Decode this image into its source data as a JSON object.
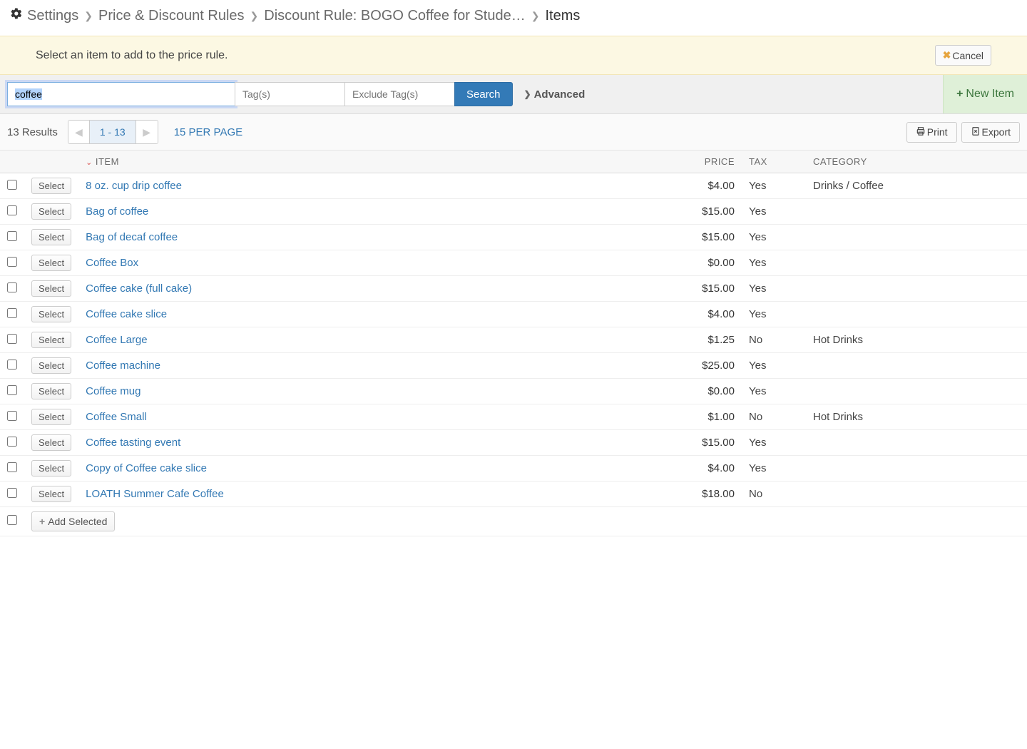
{
  "breadcrumb": {
    "settings": "Settings",
    "rules": "Price & Discount Rules",
    "rule": "Discount Rule:  BOGO Coffee for Stude…",
    "current": "Items"
  },
  "infobar": {
    "message": "Select an item to add to the price rule.",
    "cancel": "Cancel"
  },
  "search": {
    "value": "coffee",
    "tags_placeholder": "Tag(s)",
    "exclude_placeholder": "Exclude Tag(s)",
    "search_label": "Search",
    "advanced_label": "Advanced",
    "new_item_label": "New Item"
  },
  "paging": {
    "results": "13 Results",
    "range": "1 - 13",
    "per_page": "15 PER PAGE",
    "print": "Print",
    "export": "Export"
  },
  "table": {
    "headers": {
      "item": "ITEM",
      "price": "PRICE",
      "tax": "TAX",
      "category": "CATEGORY"
    },
    "select_label": "Select",
    "add_selected_label": "Add Selected",
    "rows": [
      {
        "item": "8 oz. cup drip coffee",
        "price": "$4.00",
        "tax": "Yes",
        "category": "Drinks / Coffee"
      },
      {
        "item": "Bag of coffee",
        "price": "$15.00",
        "tax": "Yes",
        "category": ""
      },
      {
        "item": "Bag of decaf coffee",
        "price": "$15.00",
        "tax": "Yes",
        "category": ""
      },
      {
        "item": "Coffee Box",
        "price": "$0.00",
        "tax": "Yes",
        "category": ""
      },
      {
        "item": "Coffee cake (full cake)",
        "price": "$15.00",
        "tax": "Yes",
        "category": ""
      },
      {
        "item": "Coffee cake slice",
        "price": "$4.00",
        "tax": "Yes",
        "category": ""
      },
      {
        "item": "Coffee Large",
        "price": "$1.25",
        "tax": "No",
        "category": "Hot Drinks"
      },
      {
        "item": "Coffee machine",
        "price": "$25.00",
        "tax": "Yes",
        "category": ""
      },
      {
        "item": "Coffee mug",
        "price": "$0.00",
        "tax": "Yes",
        "category": ""
      },
      {
        "item": "Coffee Small",
        "price": "$1.00",
        "tax": "No",
        "category": "Hot Drinks"
      },
      {
        "item": "Coffee tasting event",
        "price": "$15.00",
        "tax": "Yes",
        "category": ""
      },
      {
        "item": "Copy of Coffee cake slice",
        "price": "$4.00",
        "tax": "Yes",
        "category": ""
      },
      {
        "item": "LOATH Summer Cafe Coffee",
        "price": "$18.00",
        "tax": "No",
        "category": ""
      }
    ]
  }
}
